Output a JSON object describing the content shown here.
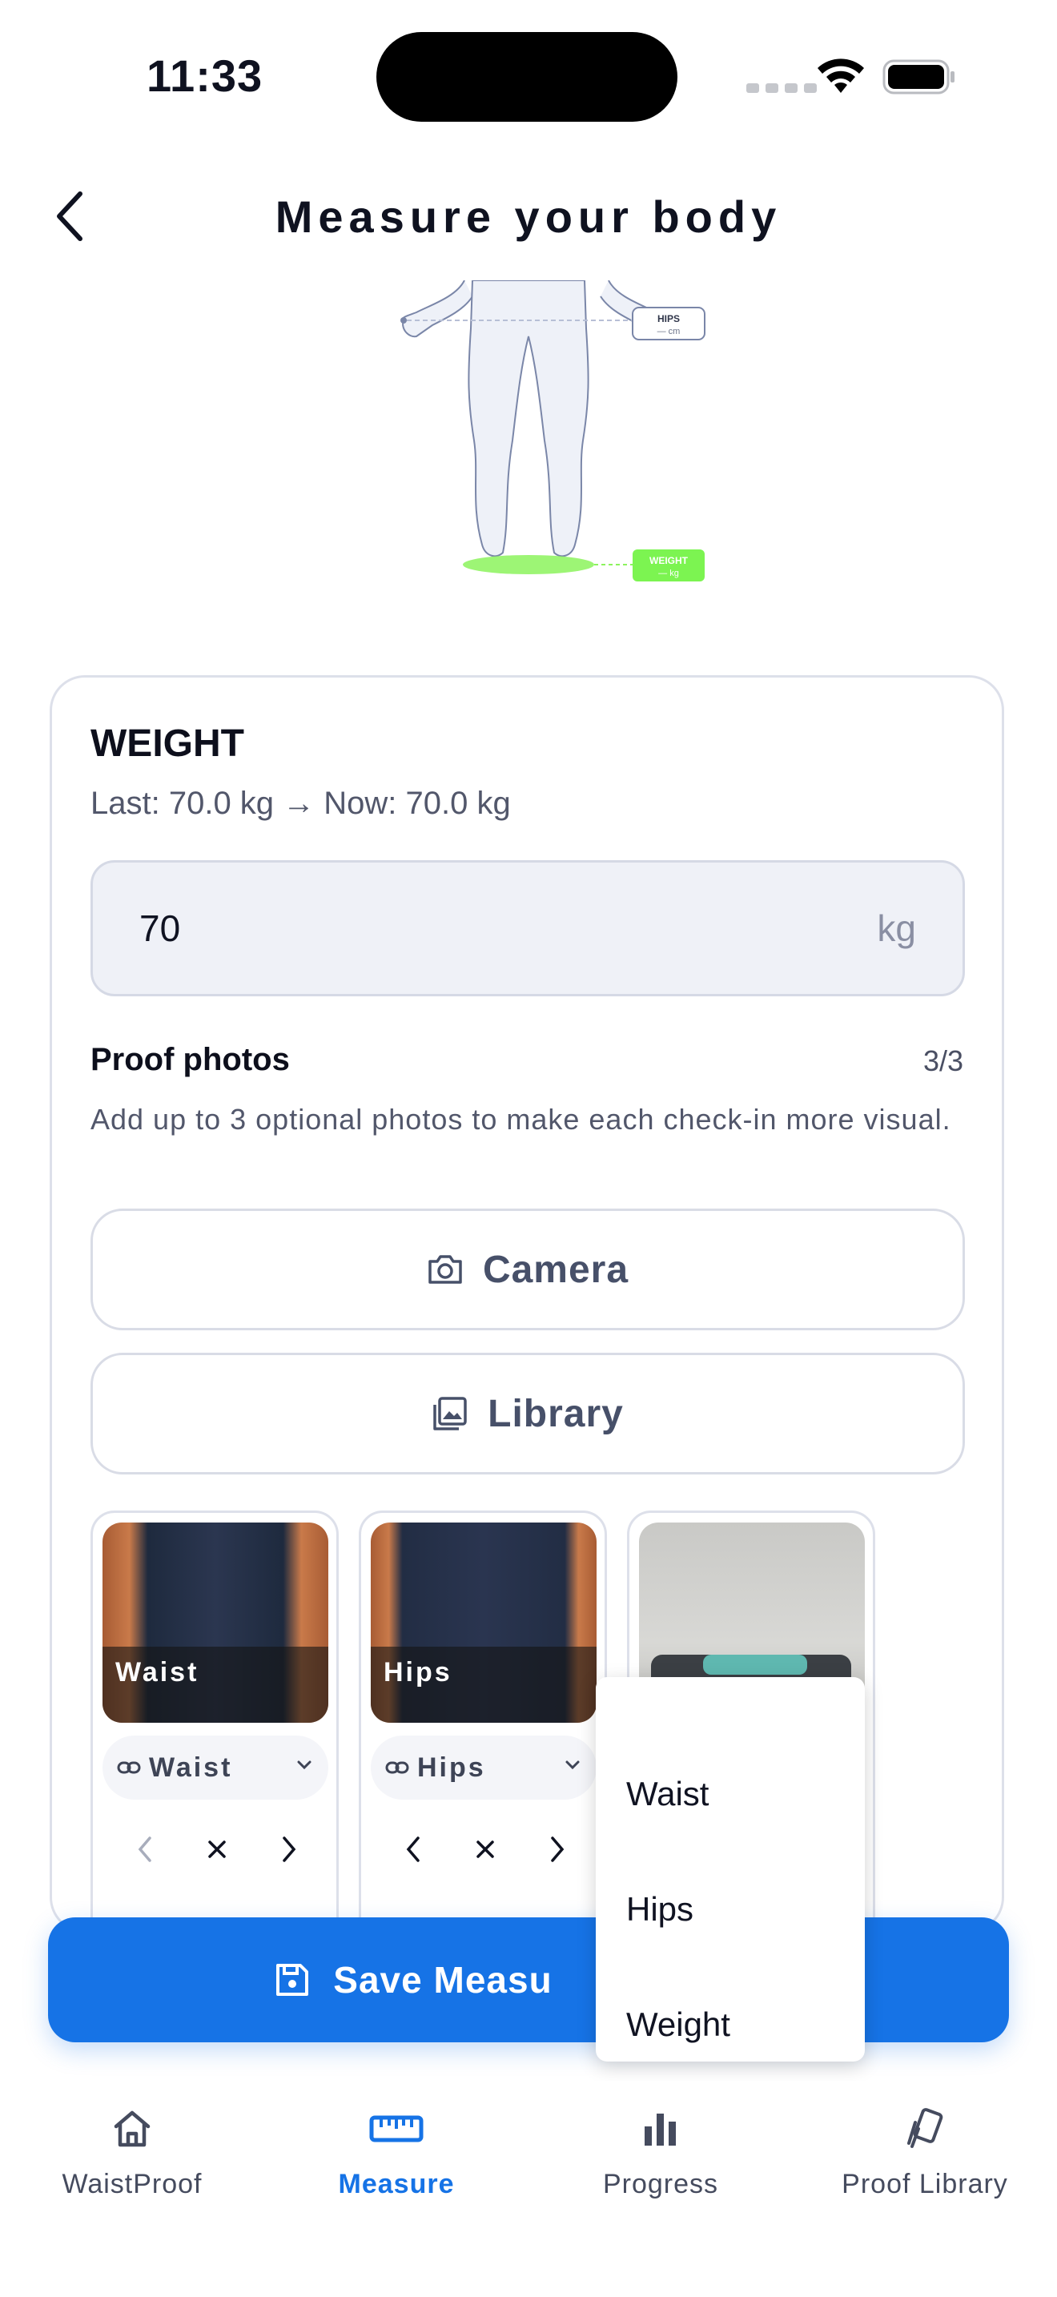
{
  "status_bar": {
    "time": "11:33"
  },
  "header": {
    "title": "Measure your body"
  },
  "figure": {
    "hips_label": "HIPS",
    "hips_value": "— cm",
    "weight_label": "WEIGHT",
    "weight_value": "— kg",
    "weight_color": "#7cf451"
  },
  "metric": {
    "title": "WEIGHT",
    "subtitle": "Last: 70.0 kg → Now: 70.0 kg",
    "value": "70",
    "unit": "kg"
  },
  "proof": {
    "title": "Proof photos",
    "count": "3/3",
    "description": "Add up to 3 optional photos to make each check-in more visual.",
    "camera_label": "Camera",
    "library_label": "Library",
    "photos": [
      {
        "label": "Waist",
        "tag": "Waist"
      },
      {
        "label": "Hips",
        "tag": "Hips"
      },
      {
        "label": "",
        "tag": ""
      }
    ]
  },
  "controls": {
    "prev": "‹",
    "remove": "×",
    "next": "›"
  },
  "save_button": {
    "label": "Save Measu"
  },
  "dropdown": {
    "options": [
      "Waist",
      "Hips",
      "Weight"
    ]
  },
  "tabbar": {
    "items": [
      {
        "label": "WaistProof",
        "icon": "home-icon"
      },
      {
        "label": "Measure",
        "icon": "ruler-icon"
      },
      {
        "label": "Progress",
        "icon": "bar-chart-icon"
      },
      {
        "label": "Proof Library",
        "icon": "cards-icon"
      }
    ],
    "active_color": "#1673e6"
  }
}
